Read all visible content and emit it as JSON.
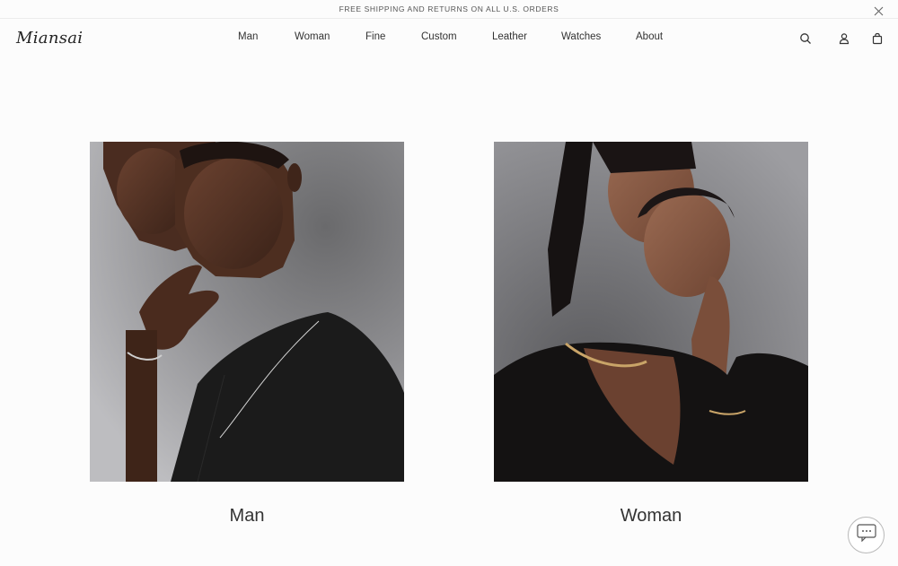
{
  "announcement": {
    "text": "FREE SHIPPING AND RETURNS ON ALL U.S. ORDERS",
    "close_icon": "close-icon"
  },
  "header": {
    "logo": "Miansai",
    "nav": [
      "Man",
      "Woman",
      "Fine",
      "Custom",
      "Leather",
      "Watches",
      "About"
    ],
    "icons": [
      "search-icon",
      "account-icon",
      "bag-icon"
    ]
  },
  "tiles": [
    {
      "label": "Man",
      "image": "man-photo"
    },
    {
      "label": "Woman",
      "image": "woman-photo"
    }
  ],
  "chat": {
    "icon": "chat-icon"
  },
  "colors": {
    "background": "#fcfcfc",
    "text": "#333333"
  }
}
